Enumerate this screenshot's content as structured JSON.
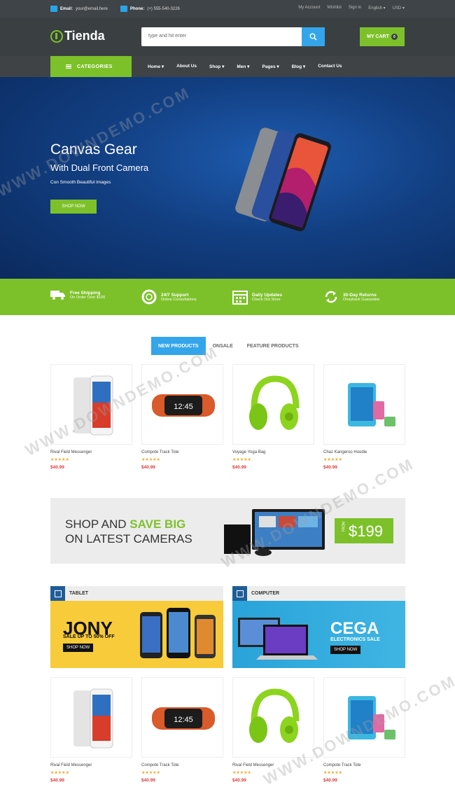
{
  "topbar": {
    "email_label": "Email:",
    "email_value": "your@email.here",
    "phone_label": "Phone:",
    "phone_value": "(+) 555-540-3226",
    "links": [
      "My Account",
      "Wishlist",
      "Sign in",
      "English",
      "USD"
    ]
  },
  "header": {
    "logo": "Tienda",
    "search_placeholder": "type and hit enter",
    "cart_label": "MY CART",
    "cart_count": "0"
  },
  "nav": {
    "categories": "CATEGORIES",
    "menu": [
      "Home",
      "About Us",
      "Shop",
      "Men",
      "Pages",
      "Blog",
      "Contact Us"
    ]
  },
  "hero": {
    "title": "Canvas Gear",
    "subtitle": "With Dual Front Camera",
    "tagline": "Con Smooth Beautiful Images",
    "button": "SHOP NOW"
  },
  "features": [
    {
      "title": "Free Shipping",
      "sub": "On Order Over $100",
      "icon": "truck-icon"
    },
    {
      "title": "24/7 Support",
      "sub": "Online Consultations",
      "icon": "lifebuoy-icon"
    },
    {
      "title": "Daily Updates",
      "sub": "Check Out Store",
      "icon": "calendar-icon"
    },
    {
      "title": "30-Day Returns",
      "sub": "Oneyback Guarantee",
      "icon": "refresh-icon"
    }
  ],
  "tabs": [
    "NEW PRODUCTS",
    "ONSALE",
    "FEATURE PRODUCTS"
  ],
  "products": [
    {
      "name": "Rival Field Messenger",
      "stars": "★★★★★",
      "price": "$40.99",
      "image": "smartphone"
    },
    {
      "name": "Compote Track Tote",
      "stars": "★★★★★",
      "price": "$40.99",
      "image": "fitness-band"
    },
    {
      "name": "Voyage Yoga Bag",
      "stars": "★★★★★",
      "price": "$40.99",
      "image": "headphones"
    },
    {
      "name": "Chaz Kangeroo Hoodie",
      "stars": "★★★★★",
      "price": "$40.99",
      "image": "music-player"
    }
  ],
  "promo": {
    "line1a": "SHOP AND ",
    "line1b": "SAVE BIG",
    "line2": "ON LATEST CAMERAS",
    "from": "FROM",
    "price": "$199"
  },
  "categories": [
    {
      "title": "TABLET",
      "brand": "JONY",
      "offer": "SALE UP TO 50% OFF",
      "button": "SHOP NOW"
    },
    {
      "title": "COMPUTER",
      "brand": "CEGA",
      "offer": "ELECTRONICS SALE",
      "button": "SHOP NOW"
    }
  ],
  "products2": [
    {
      "name": "Rival Field Messenger",
      "stars": "★★★★★",
      "price": "$40.99"
    },
    {
      "name": "Compote Track Tote",
      "stars": "★★★★★",
      "price": "$40.99"
    },
    {
      "name": "Rival Field Messenger",
      "stars": "★★★★★",
      "price": "$40.99"
    },
    {
      "name": "Compote Track Tote",
      "stars": "★★★★★",
      "price": "$40.99"
    }
  ],
  "watermark": "WWW.DOWNDEMO.COM",
  "colors": {
    "accent": "#7dc12a",
    "blue": "#34a5ea",
    "dark": "#3a3f42",
    "price": "#e03a3a"
  }
}
